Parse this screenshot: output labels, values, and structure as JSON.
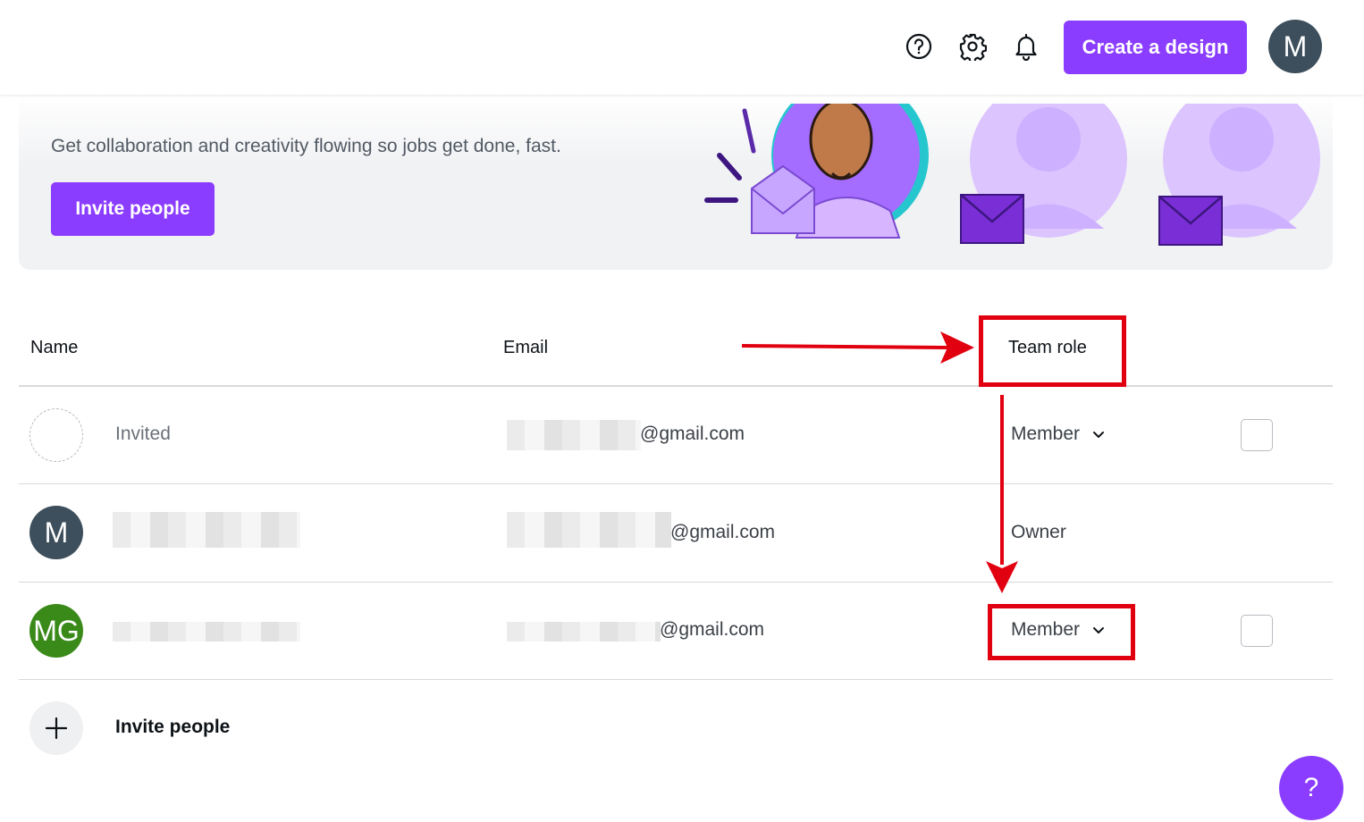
{
  "header": {
    "create_label": "Create a design",
    "avatar_initial": "M",
    "icons": [
      "help-circle-icon",
      "gear-icon",
      "bell-icon"
    ]
  },
  "banner": {
    "text": "Get collaboration and creativity flowing so jobs get done, fast.",
    "invite_label": "Invite people"
  },
  "table": {
    "columns": [
      "Name",
      "Email",
      "Team role"
    ],
    "rows": [
      {
        "name": "Invited",
        "email_suffix": "@gmail.com",
        "role": "Member",
        "has_dropdown": true,
        "has_checkbox": true
      },
      {
        "name": "",
        "avatar": "M",
        "email_suffix": "@gmail.com",
        "role": "Owner",
        "has_dropdown": false,
        "has_checkbox": false
      },
      {
        "name": "",
        "avatar": "MG",
        "email_suffix": "@gmail.com",
        "role": "Member",
        "has_dropdown": true,
        "has_checkbox": true
      }
    ],
    "invite_label": "Invite people"
  },
  "help_fab": "?",
  "colors": {
    "accent": "#8b3dff",
    "annotation": "#e1000f",
    "avatar_m": "#3d4f5c",
    "avatar_mg": "#3a8a1a"
  }
}
